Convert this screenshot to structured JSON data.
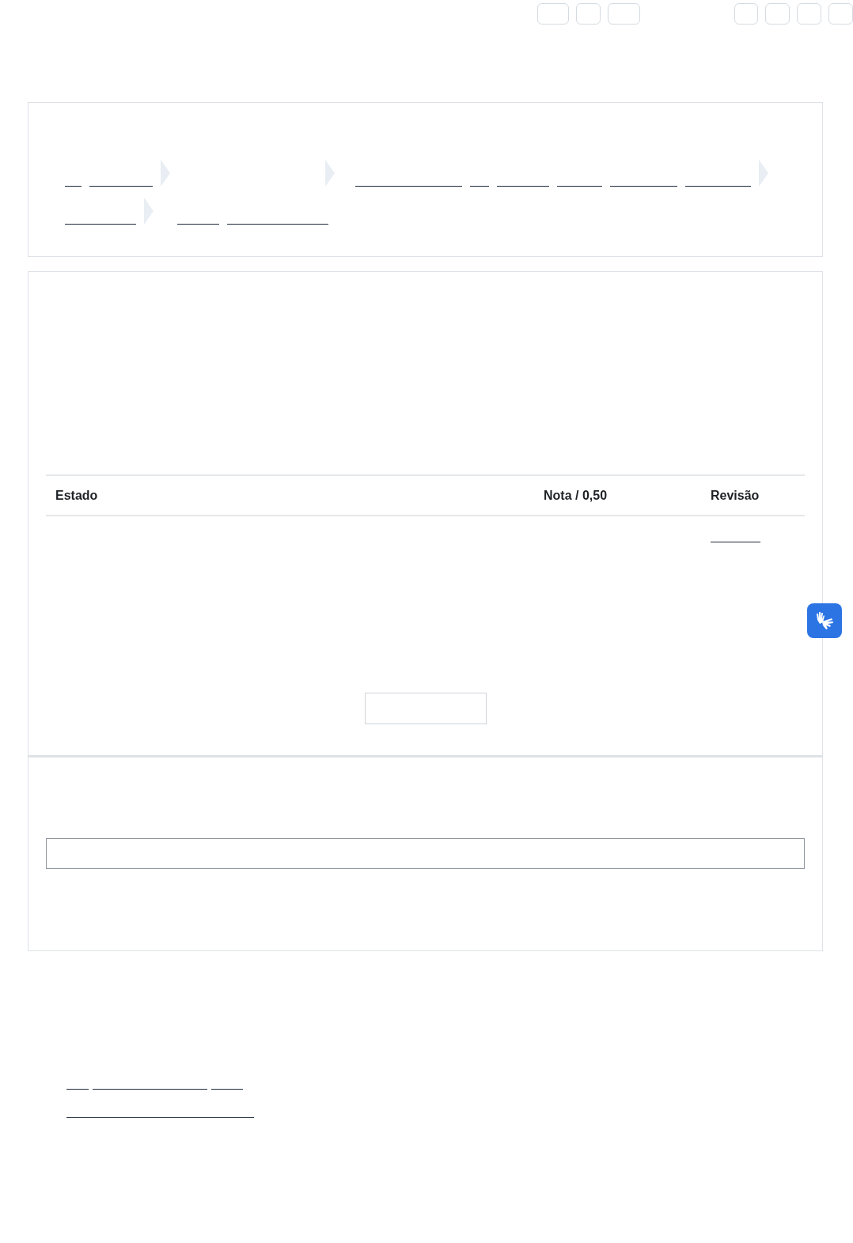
{
  "table": {
    "columns": [
      {
        "label": "Estado"
      },
      {
        "label": "Nota / 0,50"
      },
      {
        "label": "Revisão"
      }
    ]
  }
}
